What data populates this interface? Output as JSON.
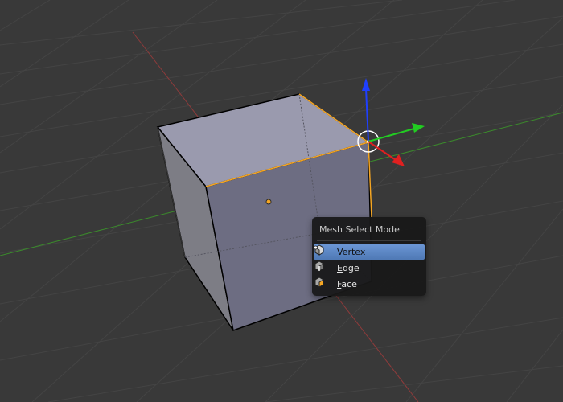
{
  "menu": {
    "title": "Mesh Select Mode",
    "items": [
      {
        "first": "V",
        "rest": "ertex",
        "active": true,
        "icon": "vertex-select-icon"
      },
      {
        "first": "E",
        "rest": "dge",
        "active": false,
        "icon": "edge-select-icon"
      },
      {
        "first": "F",
        "rest": "ace",
        "active": false,
        "icon": "face-select-icon"
      }
    ]
  },
  "colors": {
    "background": "#393939",
    "grid": "#454545",
    "x_axis": "#9b3a3a",
    "y_axis": "#3f8f2f",
    "selection": "#f5a623",
    "menu_highlight": "#5e88c6"
  }
}
